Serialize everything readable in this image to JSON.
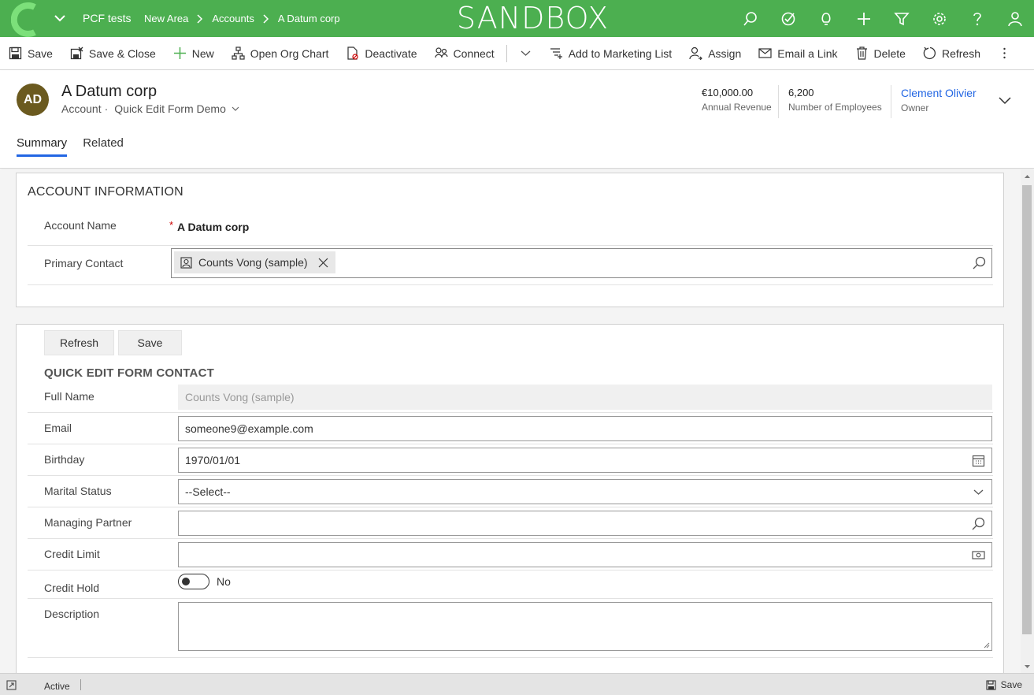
{
  "topbar": {
    "app_name": "PCF tests",
    "breadcrumbs": [
      "New Area",
      "Accounts",
      "A Datum corp"
    ],
    "environment": "SANDBOX",
    "icons": [
      "search-icon",
      "task-icon",
      "lightbulb-icon",
      "plus-icon",
      "filter-icon",
      "gear-icon",
      "help-icon",
      "user-icon"
    ]
  },
  "commands": {
    "save": "Save",
    "save_close": "Save & Close",
    "new": "New",
    "org_chart": "Open Org Chart",
    "deactivate": "Deactivate",
    "connect": "Connect",
    "marketing": "Add to Marketing List",
    "assign": "Assign",
    "email_link": "Email a Link",
    "delete": "Delete",
    "refresh": "Refresh"
  },
  "header": {
    "initials": "AD",
    "title": "A Datum corp",
    "entity": "Account",
    "dot": "·",
    "form_name": "Quick Edit Form Demo",
    "revenue_value": "€10,000.00",
    "revenue_label": "Annual Revenue",
    "employees_value": "6,200",
    "employees_label": "Number of Employees",
    "owner_value": "Clement Olivier",
    "owner_label": "Owner"
  },
  "tabs": [
    "Summary",
    "Related"
  ],
  "account_info": {
    "title": "ACCOUNT INFORMATION",
    "account_name_label": "Account Name",
    "required_marker": "*",
    "account_name_value": "A Datum corp",
    "primary_contact_label": "Primary Contact",
    "primary_contact_value": "Counts Vong (sample)"
  },
  "quick_edit": {
    "refresh_btn": "Refresh",
    "save_btn": "Save",
    "title": "QUICK EDIT FORM CONTACT",
    "full_name_label": "Full Name",
    "full_name_value": "Counts Vong (sample)",
    "email_label": "Email",
    "email_value": "someone9@example.com",
    "birthday_label": "Birthday",
    "birthday_value": "1970/01/01",
    "marital_label": "Marital Status",
    "marital_value": "--Select--",
    "partner_label": "Managing Partner",
    "partner_value": "",
    "credit_limit_label": "Credit Limit",
    "credit_limit_value": "",
    "credit_hold_label": "Credit Hold",
    "credit_hold_value": "No",
    "description_label": "Description",
    "description_value": ""
  },
  "footer": {
    "status": "Active",
    "save": "Save"
  },
  "colors": {
    "topbar": "#4caf50",
    "accent": "#2266e3",
    "avatar": "#6b5a1f"
  }
}
